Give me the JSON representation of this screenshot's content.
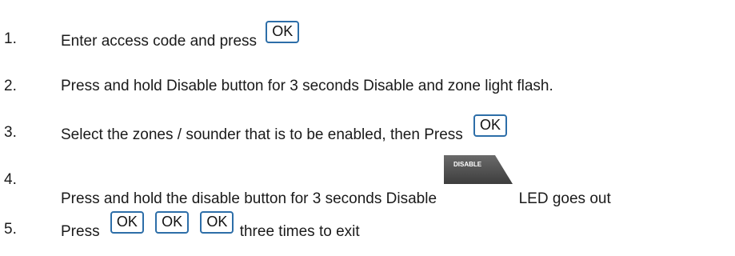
{
  "steps": [
    {
      "number": "1.",
      "text_before": "Enter access code and press",
      "button": "OK"
    },
    {
      "number": "2.",
      "text": "Press and hold Disable button for 3 seconds Disable and zone light flash."
    },
    {
      "number": "3.",
      "text_before": "Select the zones / sounder that is to be enabled, then Press",
      "button": "OK"
    },
    {
      "number": "4.",
      "text_before": "Press and hold the disable button for 3 seconds Disable",
      "disable_icon_label": "DISABLE",
      "text_after": "LED goes out"
    },
    {
      "number": "5.",
      "text_before": "Press",
      "buttons": [
        "OK",
        "OK",
        "OK"
      ],
      "text_after": "three times to exit"
    }
  ],
  "colors": {
    "ok_border": "#2d6ea8",
    "disable_fill": "#555555"
  }
}
